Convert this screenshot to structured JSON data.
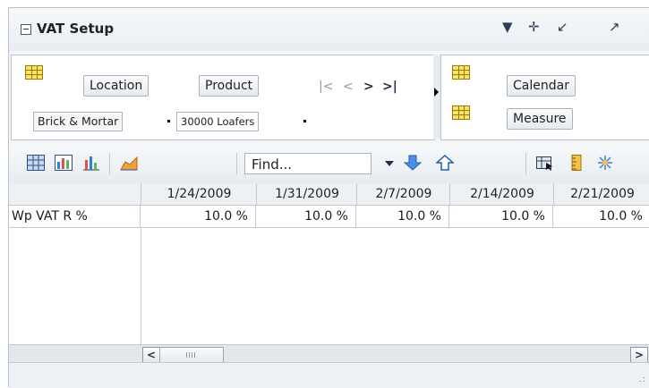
{
  "panel": {
    "title": "VAT Setup",
    "header_icons": [
      "dropdown-icon",
      "move-icon",
      "minimize-icon",
      "maximize-icon"
    ]
  },
  "controls": {
    "left_dims": [
      "Location",
      "Product"
    ],
    "right_dims": [
      "Calendar",
      "Measure"
    ],
    "members": [
      "Brick & Mortar",
      "30000 Loafers"
    ],
    "nav_icons": [
      "first-icon",
      "prev-icon",
      "next-icon",
      "last-icon"
    ]
  },
  "toolbar": {
    "find_placeholder": "Find...",
    "icons": [
      "table-view-icon",
      "chart-table-icon",
      "bar-chart-icon",
      "area-chart-icon",
      "find-down-icon",
      "find-up-icon",
      "export-icon",
      "ruler-icon",
      "sparkle-icon"
    ]
  },
  "table": {
    "columns": [
      "1/24/2009",
      "1/31/2009",
      "2/7/2009",
      "2/14/2009",
      "2/21/2009"
    ],
    "rows": [
      {
        "label": "Wp VAT R %",
        "values": [
          "10.0 %",
          "10.0 %",
          "10.0 %",
          "10.0 %",
          "10.0 %"
        ]
      }
    ]
  },
  "colors": {
    "accent_blue": "#3a7bd5",
    "border": "#c2c9d1",
    "header_bg": "#eef1f4"
  }
}
